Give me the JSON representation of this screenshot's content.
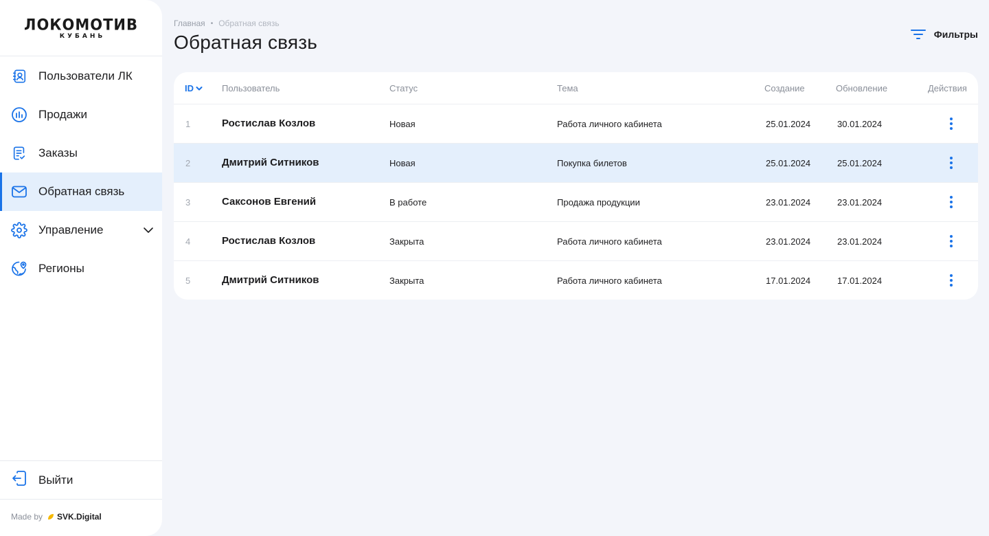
{
  "brand": {
    "logo_main": "ЛОКОМОТИВ",
    "logo_sub": "КУБАНЬ",
    "made_by": "Made by",
    "dev": "SVK.Digital"
  },
  "sidebar": {
    "items": [
      {
        "label": "Пользователи ЛК",
        "icon": "user-card-icon",
        "active": false
      },
      {
        "label": "Продажи",
        "icon": "chart-circle-icon",
        "active": false
      },
      {
        "label": "Заказы",
        "icon": "receipt-icon",
        "active": false
      },
      {
        "label": "Обратная связь",
        "icon": "mail-icon",
        "active": true
      },
      {
        "label": "Управление",
        "icon": "gear-icon",
        "active": false,
        "expandable": true
      },
      {
        "label": "Регионы",
        "icon": "globe-pin-icon",
        "active": false
      }
    ],
    "logout": "Выйти"
  },
  "header": {
    "breadcrumb": [
      "Главная",
      "Обратная связь"
    ],
    "title": "Обратная связь",
    "filters_label": "Фильтры"
  },
  "table": {
    "columns": {
      "id": "ID",
      "user": "Пользователь",
      "status": "Статус",
      "topic": "Тема",
      "created": "Создание",
      "updated": "Обновление",
      "actions": "Действия"
    },
    "rows": [
      {
        "id": "1",
        "user": "Ростислав Козлов",
        "status": "Новая",
        "topic": "Работа личного кабинета",
        "created": "25.01.2024",
        "updated": "30.01.2024",
        "highlighted": false
      },
      {
        "id": "2",
        "user": "Дмитрий Ситников",
        "status": "Новая",
        "topic": "Покупка билетов",
        "created": "25.01.2024",
        "updated": "25.01.2024",
        "highlighted": true
      },
      {
        "id": "3",
        "user": "Саксонов Евгений",
        "status": "В работе",
        "topic": "Продажа продукции",
        "created": "23.01.2024",
        "updated": "23.01.2024",
        "highlighted": false
      },
      {
        "id": "4",
        "user": "Ростислав Козлов",
        "status": "Закрыта",
        "topic": "Работа личного кабинета",
        "created": "23.01.2024",
        "updated": "23.01.2024",
        "highlighted": false
      },
      {
        "id": "5",
        "user": "Дмитрий Ситников",
        "status": "Закрыта",
        "topic": "Работа личного кабинета",
        "created": "17.01.2024",
        "updated": "17.01.2024",
        "highlighted": false
      }
    ]
  },
  "colors": {
    "accent": "#1a73e8",
    "active_bg": "#e4effc",
    "page_bg": "#f3f5fa",
    "dev_dot": "#f5b800"
  }
}
